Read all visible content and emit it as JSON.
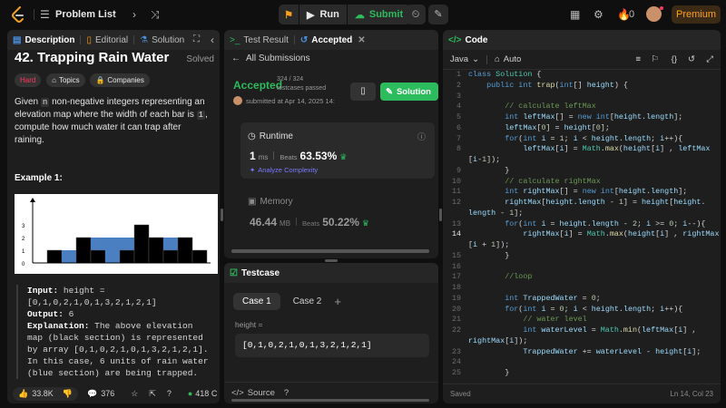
{
  "topbar": {
    "problem_list": "Problem List",
    "run": "Run",
    "submit": "Submit",
    "streak": "0",
    "premium": "Premium"
  },
  "description": {
    "tabs": [
      "Description",
      "Editorial",
      "Solution"
    ],
    "title": "42. Trapping Rain Water",
    "status": "Solved",
    "chips": {
      "difficulty": "Hard",
      "topics": "Topics",
      "companies": "Companies"
    },
    "text": {
      "p1": "Given ",
      "n": "n",
      "p2": " non-negative integers representing an elevation map where the width of each bar is ",
      "one": "1",
      "p3": ", compute how much water it can trap after raining."
    },
    "example_title": "Example 1:",
    "example": {
      "input_label": "Input:",
      "input_value": " height = [0,1,0,2,1,0,1,3,2,1,2,1]",
      "output_label": "Output:",
      "output_value": " 6",
      "explanation_label": "Explanation:",
      "explanation_value": " The above elevation map (black section) is represented by array [0,1,0,2,1,0,1,3,2,1,2,1]. In this case, 6 units of rain water (blue section) are being trapped."
    },
    "chart": {
      "heights": [
        0,
        1,
        0,
        2,
        1,
        0,
        1,
        3,
        2,
        1,
        2,
        1
      ],
      "water": [
        0,
        0,
        1,
        0,
        1,
        2,
        1,
        0,
        0,
        1,
        0,
        0
      ],
      "ticks": [
        "0",
        "1",
        "2",
        "3"
      ]
    },
    "footer": {
      "likes": "33.8K",
      "comments": "376",
      "online": "418 C"
    }
  },
  "result": {
    "tabs": [
      "Test Result",
      "Accepted"
    ],
    "all_submissions": "All Submissions",
    "status": "Accepted",
    "testcases": "324 / 324 testcases passed",
    "submitted": "submitted at Apr 14, 2025 14:",
    "solution_button": "Solution",
    "runtime": {
      "label": "Runtime",
      "value": "1",
      "unit": "ms",
      "beats_label": "Beats",
      "beats": "63.53%",
      "analyze": "Analyze Complexity"
    },
    "memory": {
      "label": "Memory",
      "value": "46.44",
      "unit": "MB",
      "beats_label": "Beats",
      "beats": "50.22%"
    }
  },
  "testcase": {
    "title": "Testcase",
    "cases": [
      "Case 1",
      "Case 2"
    ],
    "param_label": "height =",
    "param_value": "[0,1,0,2,1,0,1,3,2,1,2,1]",
    "source": "Source"
  },
  "code": {
    "title": "Code",
    "language": "Java",
    "mode": "Auto",
    "saved": "Saved",
    "cursor": "Ln 14, Col 23",
    "current_line": 14,
    "lines": [
      {
        "n": "1",
        "html": "<span class='kw'>class</span> <span class='cls'>Solution</span> {"
      },
      {
        "n": "2",
        "html": "    <span class='kw'>public</span> <span class='kw'>int</span> <span class='fn'>trap</span>(<span class='kw'>int</span>[] <span class='var'>height</span>) {"
      },
      {
        "n": "3",
        "html": ""
      },
      {
        "n": "4",
        "html": "        <span class='cm'>// calculate leftMax</span>"
      },
      {
        "n": "5",
        "html": "        <span class='kw'>int</span> <span class='var'>leftMax</span>[] = <span class='kw'>new</span> <span class='kw'>int</span>[<span class='var'>height</span>.<span class='var'>length</span>];"
      },
      {
        "n": "6",
        "html": "        <span class='var'>leftMax</span>[<span class='num'>0</span>] = <span class='var'>height</span>[<span class='num'>0</span>];"
      },
      {
        "n": "7",
        "html": "        <span class='kw'>for</span>(<span class='kw'>int</span> <span class='var'>i</span> = <span class='num'>1</span>; <span class='var'>i</span> &lt; <span class='var'>height</span>.<span class='var'>length</span>; <span class='var'>i</span>++){"
      },
      {
        "n": "8",
        "html": "            <span class='var'>leftMax</span>[<span class='var'>i</span>] = <span class='cls'>Math</span>.<span class='fn'>max</span>(<span class='var'>height</span>[<span class='var'>i</span>] , <span class='var'>leftMax</span>"
      },
      {
        "n": "",
        "html": "[<span class='var'>i</span>-<span class='num'>1</span>]);"
      },
      {
        "n": "9",
        "html": "        }"
      },
      {
        "n": "10",
        "html": "        <span class='cm'>// calculate rightMax</span>"
      },
      {
        "n": "11",
        "html": "        <span class='kw'>int</span> <span class='var'>rightMax</span>[] = <span class='kw'>new</span> <span class='kw'>int</span>[<span class='var'>height</span>.<span class='var'>length</span>];"
      },
      {
        "n": "12",
        "html": "        <span class='var'>rightMax</span>[<span class='var'>height</span>.<span class='var'>length</span> - <span class='num'>1</span>] = <span class='var'>height</span>[<span class='var'>height</span>."
      },
      {
        "n": "",
        "html": "<span class='var'>length</span> - <span class='num'>1</span>];"
      },
      {
        "n": "13",
        "html": "        <span class='kw'>for</span>(<span class='kw'>int</span> <span class='var'>i</span> = <span class='var'>height</span>.<span class='var'>length</span> - <span class='num'>2</span>; <span class='var'>i</span> &gt;= <span class='num'>0</span>; <span class='var'>i</span>--){"
      },
      {
        "n": "14",
        "html": "            <span class='var'>rightMax</span>[<span class='var'>i</span>] = <span class='cls'>Math</span>.<span class='fn'>max</span>(<span class='var'>height</span>[<span class='var'>i</span>] , <span class='var'>rightMax</span>"
      },
      {
        "n": "",
        "html": "[<span class='var'>i</span> + <span class='num'>1</span>]);"
      },
      {
        "n": "15",
        "html": "        }"
      },
      {
        "n": "16",
        "html": ""
      },
      {
        "n": "17",
        "html": "        <span class='cm'>//loop</span>"
      },
      {
        "n": "18",
        "html": ""
      },
      {
        "n": "19",
        "html": "        <span class='kw'>int</span> <span class='var'>TrappedWater</span> = <span class='num'>0</span>;"
      },
      {
        "n": "20",
        "html": "        <span class='kw'>for</span>(<span class='kw'>int</span> <span class='var'>i</span> = <span class='num'>0</span>; <span class='var'>i</span> &lt; <span class='var'>height</span>.<span class='var'>length</span>; <span class='var'>i</span>++){"
      },
      {
        "n": "21",
        "html": "            <span class='cm'>// water level</span>"
      },
      {
        "n": "22",
        "html": "            <span class='kw'>int</span> <span class='var'>waterLevel</span> = <span class='cls'>Math</span>.<span class='fn'>min</span>(<span class='var'>leftMax</span>[<span class='var'>i</span>] ,"
      },
      {
        "n": "",
        "html": "<span class='var'>rightMax</span>[<span class='var'>i</span>]);"
      },
      {
        "n": "23",
        "html": "            <span class='var'>TrappedWater</span> += <span class='var'>waterLevel</span> - <span class='var'>height</span>[<span class='var'>i</span>];"
      },
      {
        "n": "24",
        "html": ""
      },
      {
        "n": "25",
        "html": "        }"
      }
    ]
  },
  "colors": {
    "accent_green": "#2cbb5d",
    "accent_orange": "#ffa116",
    "hard_red": "#ff375f",
    "water_blue": "#4a7fc1"
  }
}
